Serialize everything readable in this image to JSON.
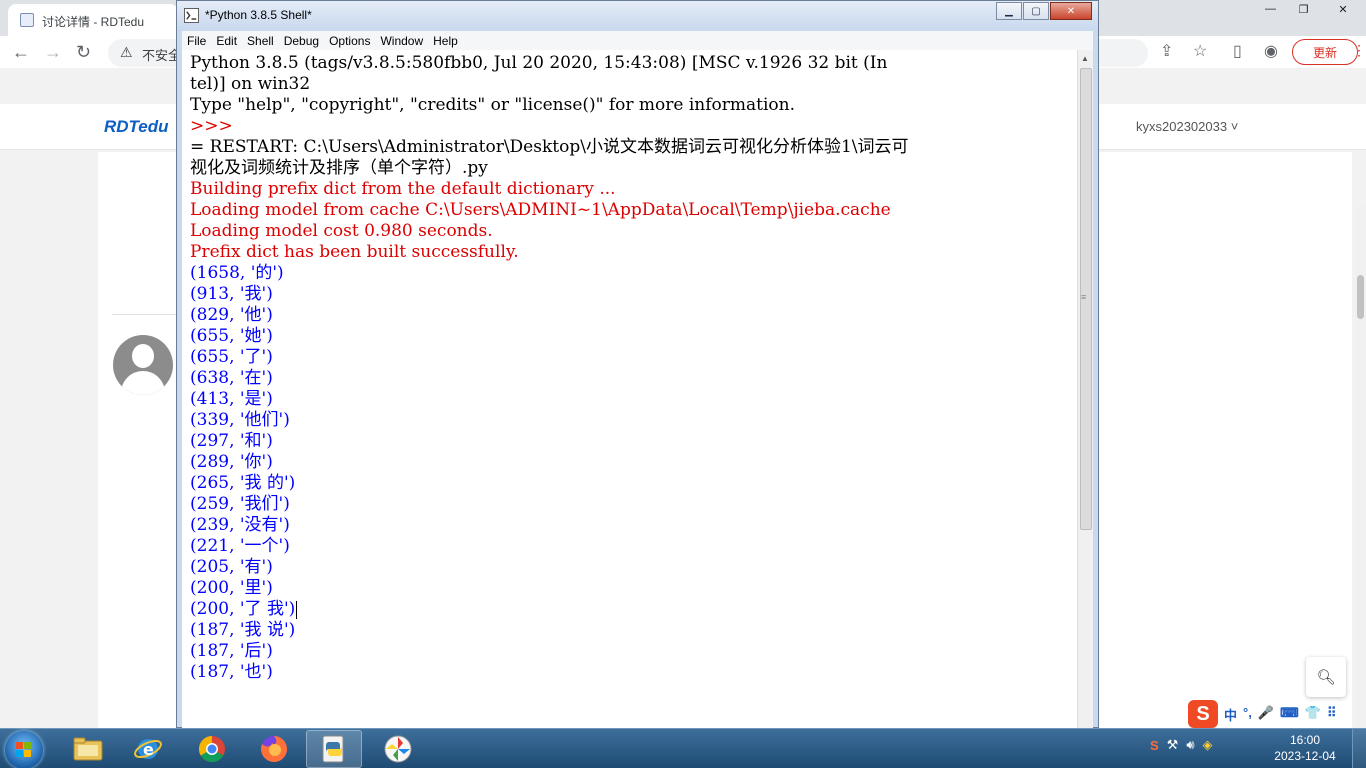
{
  "browser": {
    "tab_title": "讨论详情 - RDTedu",
    "address_insecure": "不安全",
    "update_label": "更新",
    "site_logo": "RDTedu",
    "user_name": "kyxs202302033",
    "user_chevron": "˅"
  },
  "idle": {
    "title": "*Python 3.8.5 Shell*",
    "menu": [
      "File",
      "Edit",
      "Shell",
      "Debug",
      "Options",
      "Window",
      "Help"
    ],
    "lines": [
      {
        "text": "Python 3.8.5 (tags/v3.8.5:580fbb0, Jul 20 2020, 15:43:08) [MSC v.1926 32 bit (In",
        "color": "black"
      },
      {
        "text": "tel)] on win32",
        "color": "black"
      },
      {
        "text": "Type \"help\", \"copyright\", \"credits\" or \"license()\" for more information.",
        "color": "black"
      },
      {
        "text": ">>> ",
        "color": "red"
      },
      {
        "text": "= RESTART: C:\\Users\\Administrator\\Desktop\\小说文本数据词云可视化分析体验1\\词云可",
        "color": "black"
      },
      {
        "text": "视化及词频统计及排序（单个字符）.py",
        "color": "black"
      },
      {
        "text": "Building prefix dict from the default dictionary ...",
        "color": "red"
      },
      {
        "text": "Loading model from cache C:\\Users\\ADMINI~1\\AppData\\Local\\Temp\\jieba.cache",
        "color": "red"
      },
      {
        "text": "Loading model cost 0.980 seconds.",
        "color": "red"
      },
      {
        "text": "Prefix dict has been built successfully.",
        "color": "red"
      },
      {
        "text": "(1658, '的')",
        "color": "blue"
      },
      {
        "text": "(913, '我')",
        "color": "blue"
      },
      {
        "text": "(829, '他')",
        "color": "blue"
      },
      {
        "text": "(655, '她')",
        "color": "blue"
      },
      {
        "text": "(655, '了')",
        "color": "blue"
      },
      {
        "text": "(638, '在')",
        "color": "blue"
      },
      {
        "text": "(413, '是')",
        "color": "blue"
      },
      {
        "text": "(339, '他们')",
        "color": "blue"
      },
      {
        "text": "(297, '和')",
        "color": "blue"
      },
      {
        "text": "(289, '你')",
        "color": "blue"
      },
      {
        "text": "(265, '我 的')",
        "color": "blue"
      },
      {
        "text": "(259, '我们')",
        "color": "blue"
      },
      {
        "text": "(239, '没有')",
        "color": "blue"
      },
      {
        "text": "(221, '一个')",
        "color": "blue"
      },
      {
        "text": "(205, '有')",
        "color": "blue"
      },
      {
        "text": "(200, '里')",
        "color": "blue"
      },
      {
        "text": "(200, '了 我')",
        "color": "blue"
      },
      {
        "text": "(187, '我 说')",
        "color": "blue"
      },
      {
        "text": "(187, '后')",
        "color": "blue"
      },
      {
        "text": "(187, '也')",
        "color": "blue"
      }
    ]
  },
  "ime": {
    "logo": "S",
    "items": [
      "中",
      "°,",
      "🎤",
      "⌨",
      "👕",
      "⠿"
    ]
  },
  "taskbar": {
    "time": "16:00",
    "date": "2023-12-04",
    "apps": [
      "explorer-icon",
      "ie-icon",
      "chrome-icon",
      "firefox-icon",
      "python-icon",
      "pinwheel-icon"
    ]
  },
  "colors": {
    "idle_black": "#000000",
    "idle_red": "#dd0000",
    "idle_blue": "#0000ff",
    "idle_frame": "#c9d9ee"
  }
}
